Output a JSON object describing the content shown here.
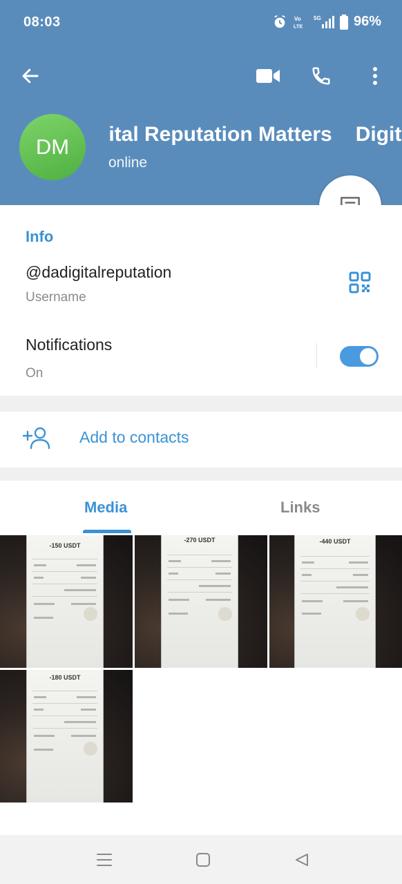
{
  "status_bar": {
    "time": "08:03",
    "battery": "96%",
    "network": "5G"
  },
  "header": {
    "avatar_initials": "DM",
    "title": "Digital Reputation Matters",
    "subtitle": "online",
    "background_color": "#5a8cbb"
  },
  "toolbar": {
    "back_icon": "arrow-left-icon",
    "video_icon": "video-call-icon",
    "call_icon": "phone-icon",
    "more_icon": "more-vertical-icon"
  },
  "info": {
    "section_title": "Info",
    "username": "@dadigitalreputation",
    "username_label": "Username",
    "notifications_title": "Notifications",
    "notifications_state": "On",
    "notifications_enabled": true
  },
  "actions": {
    "add_contact": "Add to contacts"
  },
  "tabs": [
    {
      "label": "Media",
      "active": true
    },
    {
      "label": "Links",
      "active": false
    }
  ],
  "media": [
    {
      "amount": "-150 USDT"
    },
    {
      "amount": "-270 USDT"
    },
    {
      "amount": "-440 USDT"
    },
    {
      "amount": "-180 USDT"
    }
  ],
  "colors": {
    "accent": "#3a92d4",
    "avatar": "#5cb84a"
  }
}
